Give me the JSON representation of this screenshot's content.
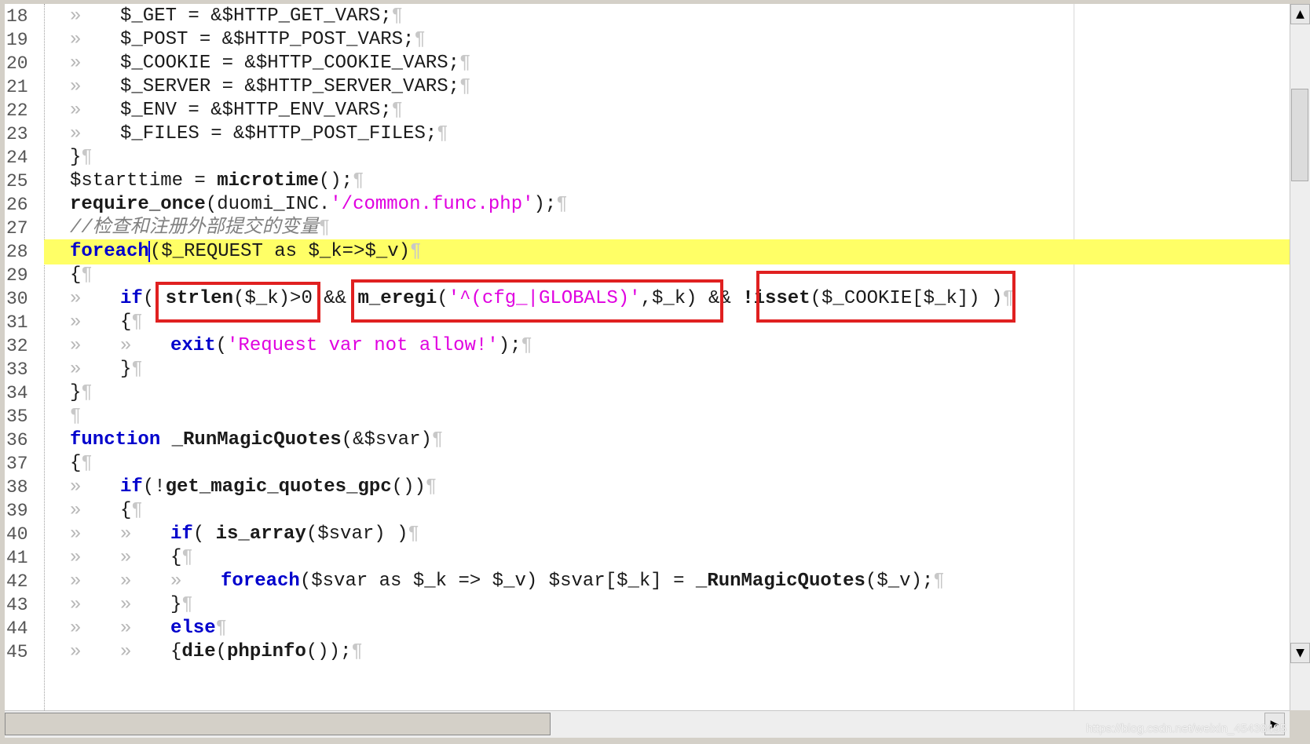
{
  "lines": [
    {
      "n": "18",
      "tabs": 1,
      "t": [
        {
          "c": "$_GET = &$HTTP_GET_VARS;",
          "k": "p"
        }
      ]
    },
    {
      "n": "19",
      "tabs": 1,
      "t": [
        {
          "c": "$_POST = &$HTTP_POST_VARS;",
          "k": "p"
        }
      ]
    },
    {
      "n": "20",
      "tabs": 1,
      "t": [
        {
          "c": "$_COOKIE = &$HTTP_COOKIE_VARS;",
          "k": "p"
        }
      ]
    },
    {
      "n": "21",
      "tabs": 1,
      "t": [
        {
          "c": "$_SERVER = &$HTTP_SERVER_VARS;",
          "k": "p"
        }
      ]
    },
    {
      "n": "22",
      "tabs": 1,
      "t": [
        {
          "c": "$_ENV = &$HTTP_ENV_VARS;",
          "k": "p"
        }
      ]
    },
    {
      "n": "23",
      "tabs": 1,
      "t": [
        {
          "c": "$_FILES = &$HTTP_POST_FILES;",
          "k": "p"
        }
      ]
    },
    {
      "n": "24",
      "tabs": 0,
      "t": [
        {
          "c": "}",
          "k": "p"
        }
      ]
    },
    {
      "n": "25",
      "tabs": 0,
      "t": [
        {
          "c": "$starttime = ",
          "k": "p"
        },
        {
          "c": "microtime",
          "k": "f"
        },
        {
          "c": "();",
          "k": "p"
        }
      ]
    },
    {
      "n": "26",
      "tabs": 0,
      "t": [
        {
          "c": "require_once",
          "k": "f"
        },
        {
          "c": "(duomi_INC.",
          "k": "p"
        },
        {
          "c": "'/common.func.php'",
          "k": "s"
        },
        {
          "c": ");",
          "k": "p"
        }
      ]
    },
    {
      "n": "27",
      "tabs": 0,
      "t": [
        {
          "c": "//检查和注册外部提交的变量",
          "k": "c"
        }
      ]
    },
    {
      "n": "28",
      "tabs": 0,
      "hl": true,
      "t": [
        {
          "c": "foreach",
          "k": "k"
        },
        {
          "c": "|",
          "k": "caret"
        },
        {
          "c": "($_REQUEST as $_k=>$_v)",
          "k": "p"
        }
      ]
    },
    {
      "n": "29",
      "tabs": 0,
      "t": [
        {
          "c": "{",
          "k": "p"
        }
      ]
    },
    {
      "n": "30",
      "tabs": 1,
      "t": [
        {
          "c": "if",
          "k": "k"
        },
        {
          "c": "( ",
          "k": "p"
        },
        {
          "c": "strlen",
          "k": "f"
        },
        {
          "c": "($_k)>0 && ",
          "k": "p"
        },
        {
          "c": "m_eregi",
          "k": "f"
        },
        {
          "c": "(",
          "k": "p"
        },
        {
          "c": "'^(cfg_|GLOBALS)'",
          "k": "s"
        },
        {
          "c": ",$_k) && ",
          "k": "p"
        },
        {
          "c": "!isset",
          "k": "f"
        },
        {
          "c": "($_COOKIE[$_k]) )",
          "k": "p"
        }
      ]
    },
    {
      "n": "31",
      "tabs": 1,
      "t": [
        {
          "c": "{",
          "k": "p"
        }
      ]
    },
    {
      "n": "32",
      "tabs": 2,
      "t": [
        {
          "c": "exit",
          "k": "k"
        },
        {
          "c": "(",
          "k": "p"
        },
        {
          "c": "'Request var not allow!'",
          "k": "s"
        },
        {
          "c": ");",
          "k": "p"
        }
      ]
    },
    {
      "n": "33",
      "tabs": 1,
      "t": [
        {
          "c": "}",
          "k": "p"
        }
      ]
    },
    {
      "n": "34",
      "tabs": 0,
      "t": [
        {
          "c": "}",
          "k": "p"
        }
      ]
    },
    {
      "n": "35",
      "tabs": 0,
      "t": []
    },
    {
      "n": "36",
      "tabs": 0,
      "t": [
        {
          "c": "function",
          "k": "k"
        },
        {
          "c": " ",
          "k": "p"
        },
        {
          "c": "_RunMagicQuotes",
          "k": "f"
        },
        {
          "c": "(&$svar)",
          "k": "p"
        }
      ]
    },
    {
      "n": "37",
      "tabs": 0,
      "t": [
        {
          "c": "{",
          "k": "p"
        }
      ]
    },
    {
      "n": "38",
      "tabs": 1,
      "t": [
        {
          "c": "if",
          "k": "k"
        },
        {
          "c": "(!",
          "k": "p"
        },
        {
          "c": "get_magic_quotes_gpc",
          "k": "f"
        },
        {
          "c": "())",
          "k": "p"
        }
      ]
    },
    {
      "n": "39",
      "tabs": 1,
      "t": [
        {
          "c": "{",
          "k": "p"
        }
      ]
    },
    {
      "n": "40",
      "tabs": 2,
      "t": [
        {
          "c": "if",
          "k": "k"
        },
        {
          "c": "( ",
          "k": "p"
        },
        {
          "c": "is_array",
          "k": "f"
        },
        {
          "c": "($svar) )",
          "k": "p"
        }
      ]
    },
    {
      "n": "41",
      "tabs": 2,
      "t": [
        {
          "c": "{",
          "k": "p"
        }
      ]
    },
    {
      "n": "42",
      "tabs": 3,
      "t": [
        {
          "c": "foreach",
          "k": "k"
        },
        {
          "c": "($svar as $_k => $_v) $svar[$_k] = ",
          "k": "p"
        },
        {
          "c": "_RunMagicQuotes",
          "k": "f"
        },
        {
          "c": "($_v);",
          "k": "p"
        }
      ]
    },
    {
      "n": "43",
      "tabs": 2,
      "t": [
        {
          "c": "}",
          "k": "p"
        }
      ]
    },
    {
      "n": "44",
      "tabs": 2,
      "t": [
        {
          "c": "else",
          "k": "k"
        }
      ]
    },
    {
      "n": "45",
      "tabs": 2,
      "t": [
        {
          "c": "{",
          "k": "p"
        },
        {
          "c": "die",
          "k": "f"
        },
        {
          "c": "(",
          "k": "p"
        },
        {
          "c": "phpinfo",
          "k": "f"
        },
        {
          "c": "());",
          "k": "p"
        }
      ]
    }
  ],
  "tab_glyph": "»",
  "pilcrow": "¶",
  "watermark": "https://blog.csdn.net/weixin_45438495",
  "colors": {
    "keyword": "#0000cc",
    "string": "#e000e0",
    "comment": "#808080",
    "highlight": "#ffff66",
    "annotation_box": "#e02020"
  },
  "icons": {
    "scroll_up": "triangle-up-icon",
    "scroll_down": "triangle-down-icon",
    "scroll_right": "triangle-right-icon"
  }
}
